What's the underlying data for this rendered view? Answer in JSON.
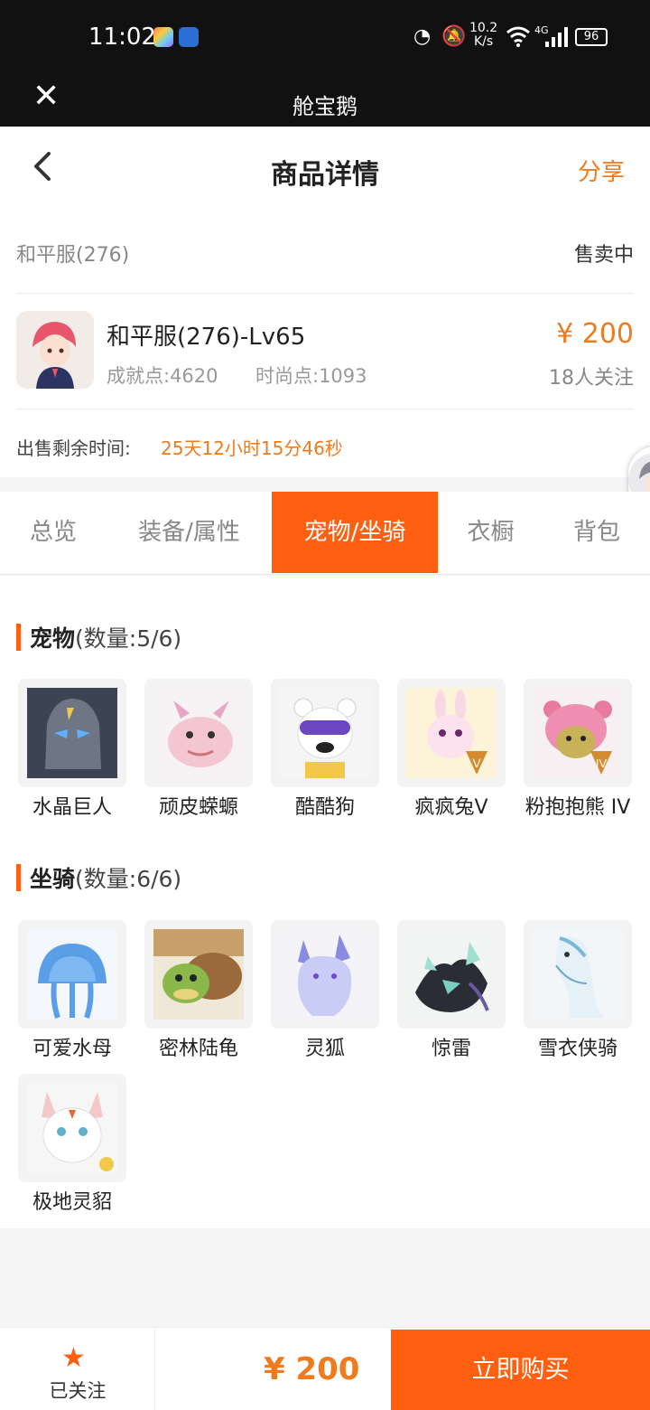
{
  "status_bar": {
    "time": "11:02",
    "net_speed_value": "10.2",
    "net_speed_unit": "K/s",
    "signal": "4G",
    "battery": "96"
  },
  "app_bar": {
    "title": "舱宝鹅"
  },
  "header": {
    "title": "商品详情",
    "share": "分享"
  },
  "product": {
    "server": "和平服(276)",
    "status": "售卖中",
    "name": "和平服(276)-Lv65",
    "achievement": "成就点:4620",
    "fashion": "时尚点:1093",
    "price": "¥ 200",
    "followers": "18人关注",
    "remaining_label": "出售剩余时间:",
    "remaining_value": "25天12小时15分46秒"
  },
  "tabs": [
    "总览",
    "装备/属性",
    "宠物/坐骑",
    "衣橱",
    "背包"
  ],
  "active_tab": "宠物/坐骑",
  "pets": {
    "title": "宠物",
    "count": "(数量:5/6)",
    "items": [
      "水晶巨人",
      "顽皮蝾螈",
      "酷酷狗",
      "疯疯兔V",
      "粉抱抱熊 IV"
    ]
  },
  "mounts": {
    "title": "坐骑",
    "count": "(数量:6/6)",
    "items": [
      "可爱水母",
      "密林陆龟",
      "灵狐",
      "惊雷",
      "雪衣侠骑",
      "极地灵貂"
    ]
  },
  "bottom_bar": {
    "follow_label": "已关注",
    "price": "¥ 200",
    "buy_label": "立即购买"
  },
  "colors": {
    "accent": "#ff5f0f",
    "price": "#f07a1e"
  }
}
